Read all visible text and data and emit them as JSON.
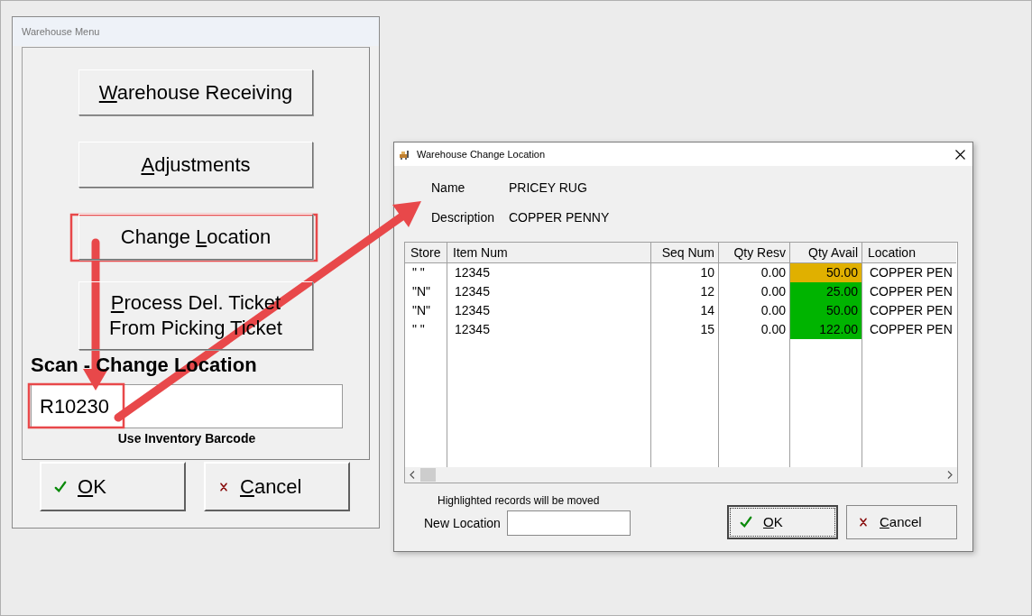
{
  "menu_window": {
    "title": "Warehouse Menu",
    "buttons": [
      {
        "parts": [
          {
            "text": "W",
            "underline": true
          },
          {
            "text": "arehouse Receiving",
            "underline": false
          }
        ]
      },
      {
        "parts": [
          {
            "text": "A",
            "underline": true
          },
          {
            "text": "djustments",
            "underline": false
          }
        ]
      },
      {
        "parts": [
          {
            "text": "Change ",
            "underline": false
          },
          {
            "text": "L",
            "underline": true
          },
          {
            "text": "ocation",
            "underline": false
          }
        ]
      },
      {
        "parts": [
          {
            "text": "P",
            "underline": true
          },
          {
            "text": "rocess Del. Ticket From Picking Ticket",
            "underline": false
          }
        ]
      }
    ],
    "scan_heading": "Scan - Change Location",
    "scan_field": {
      "value": "R10230"
    },
    "scan_hint": "Use Inventory Barcode",
    "ok_button": {
      "parts": [
        {
          "text": "O",
          "underline": true
        },
        {
          "text": "K",
          "underline": false
        }
      ]
    },
    "cancel_button": {
      "parts": [
        {
          "text": "C",
          "underline": true
        },
        {
          "text": "ancel",
          "underline": false
        }
      ]
    }
  },
  "dialog": {
    "title": "Warehouse Change Location",
    "name_label": "Name",
    "name_value": "PRICEY RUG",
    "description_label": "Description",
    "description_value": "COPPER PENNY",
    "table": {
      "columns": [
        "Store",
        "Item Num",
        "Seq Num",
        "Qty Resv",
        "Qty Avail",
        "Location"
      ],
      "rows": [
        {
          "store": "\" \"",
          "item_num": "12345",
          "seq_num": "10",
          "qty_resv": "0.00",
          "qty_avail": "50.00",
          "color": "#e0b000",
          "location": "COPPER PEN"
        },
        {
          "store": "\"N\"",
          "item_num": "12345",
          "seq_num": "12",
          "qty_resv": "0.00",
          "qty_avail": "25.00",
          "color": "#00b400",
          "location": "COPPER PEN"
        },
        {
          "store": "\"N\"",
          "item_num": "12345",
          "seq_num": "14",
          "qty_resv": "0.00",
          "qty_avail": "50.00",
          "color": "#00b400",
          "location": "COPPER PEN"
        },
        {
          "store": "\" \"",
          "item_num": "12345",
          "seq_num": "15",
          "qty_resv": "0.00",
          "qty_avail": "122.00",
          "color": "#00b400",
          "location": "COPPER PEN"
        }
      ]
    },
    "footer_note": "Highlighted records will be moved",
    "new_location_label": "New Location",
    "ok_button": {
      "parts": [
        {
          "text": "O",
          "underline": true
        },
        {
          "text": "K",
          "underline": false
        }
      ]
    },
    "cancel_button": {
      "parts": [
        {
          "text": "C",
          "underline": true
        },
        {
          "text": "ancel",
          "underline": false
        }
      ]
    }
  }
}
